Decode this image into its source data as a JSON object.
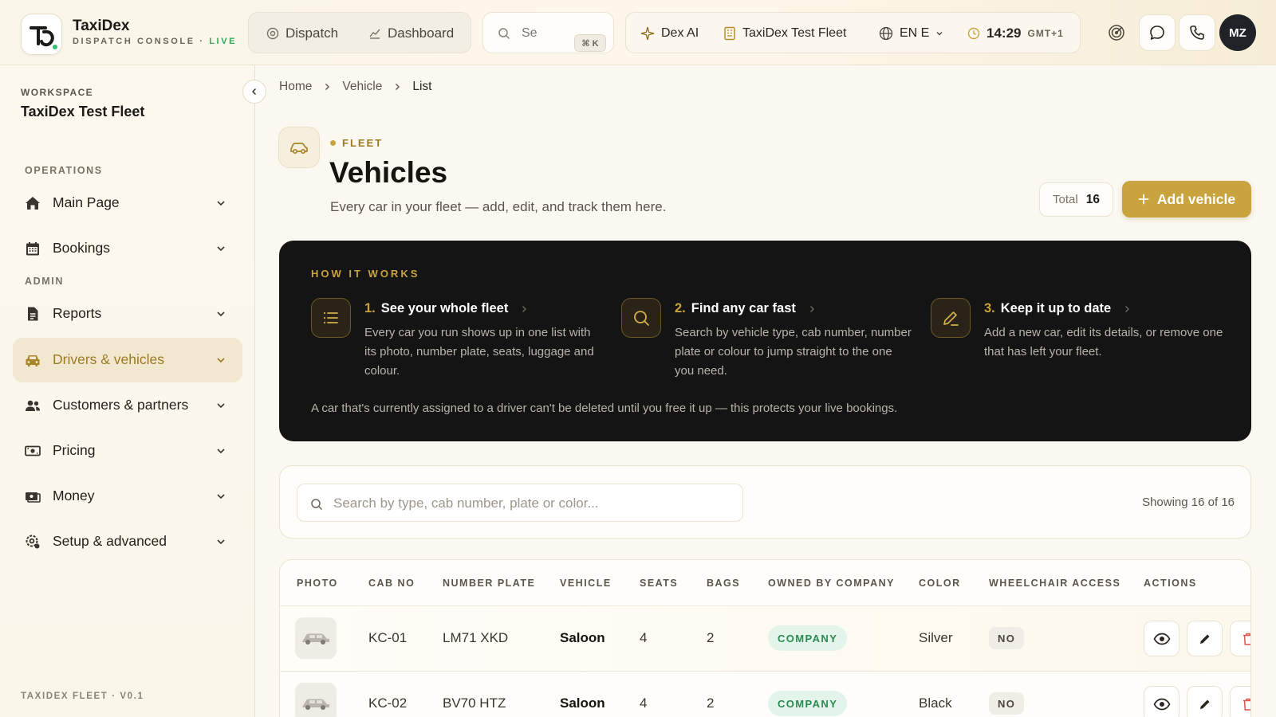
{
  "brand": {
    "name": "TaxiDex",
    "subtitle": "DISPATCH CONSOLE · ",
    "live": "LIVE"
  },
  "topnav": {
    "dispatch": "Dispatch",
    "dashboard": "Dashboard"
  },
  "search": {
    "placeholder": "Se",
    "shortcut": "⌘ K"
  },
  "tools": {
    "ai": "Dex AI",
    "fleet": "TaxiDex Test Fleet",
    "language": "EN E",
    "time": "14:29",
    "timezone": "GMT+1"
  },
  "user": {
    "initials": "MZ"
  },
  "sidebar": {
    "workspace_label": "WORKSPACE",
    "workspace_name": "TaxiDex Test Fleet",
    "operations_label": "OPERATIONS",
    "admin_label": "ADMIN",
    "items": [
      {
        "label": "Main Page",
        "icon": "home-icon"
      },
      {
        "label": "Bookings",
        "icon": "calendar-icon"
      },
      {
        "label": "Reports",
        "icon": "report-icon"
      },
      {
        "label": "Drivers & vehicles",
        "icon": "car-icon"
      },
      {
        "label": "Customers & partners",
        "icon": "users-icon"
      },
      {
        "label": "Pricing",
        "icon": "cash-icon"
      },
      {
        "label": "Money",
        "icon": "money-icon"
      },
      {
        "label": "Setup & advanced",
        "icon": "settings-icon"
      }
    ],
    "footer": "TAXIDEX FLEET · V0.1"
  },
  "breadcrumb": [
    "Home",
    "Vehicle",
    "List"
  ],
  "page": {
    "eyebrow": "FLEET",
    "title": "Vehicles",
    "subtitle": "Every car in your fleet — add, edit, and track them here.",
    "total_label": "Total",
    "total_value": "16",
    "add_button": "Add vehicle"
  },
  "how_it_works": {
    "label": "HOW IT WORKS",
    "steps": [
      {
        "num": "1.",
        "title": "See your whole fleet",
        "desc": "Every car you run shows up in one list with its photo, number plate, seats, luggage and colour.",
        "icon": "list-icon"
      },
      {
        "num": "2.",
        "title": "Find any car fast",
        "desc": "Search by vehicle type, cab number, number plate or colour to jump straight to the one you need.",
        "icon": "search-icon"
      },
      {
        "num": "3.",
        "title": "Keep it up to date",
        "desc": "Add a new car, edit its details, or remove one that has left your fleet.",
        "icon": "edit-icon"
      }
    ],
    "note": "A car that's currently assigned to a driver can't be deleted until you free it up — this protects your live bookings."
  },
  "filter": {
    "placeholder": "Search by type, cab number, plate or color...",
    "showing": "Showing 16 of 16"
  },
  "table": {
    "headers": [
      "PHOTO",
      "CAB NO",
      "NUMBER PLATE",
      "VEHICLE",
      "SEATS",
      "BAGS",
      "OWNED BY COMPANY",
      "COLOR",
      "WHEELCHAIR ACCESS",
      "ACTIONS"
    ],
    "rows": [
      {
        "cab": "KC-01",
        "plate": "LM71 XKD",
        "vehicle": "Saloon",
        "seats": "4",
        "bags": "2",
        "owned": "COMPANY",
        "color": "Silver",
        "wheelchair": "NO"
      },
      {
        "cab": "KC-02",
        "plate": "BV70 HTZ",
        "vehicle": "Saloon",
        "seats": "4",
        "bags": "2",
        "owned": "COMPANY",
        "color": "Black",
        "wheelchair": "NO"
      }
    ]
  },
  "colors": {
    "accent": "#c9a33e",
    "dark_panel": "#141414",
    "live": "#2fa85a",
    "company_badge": "#2b8a50",
    "danger": "#e0524c"
  }
}
